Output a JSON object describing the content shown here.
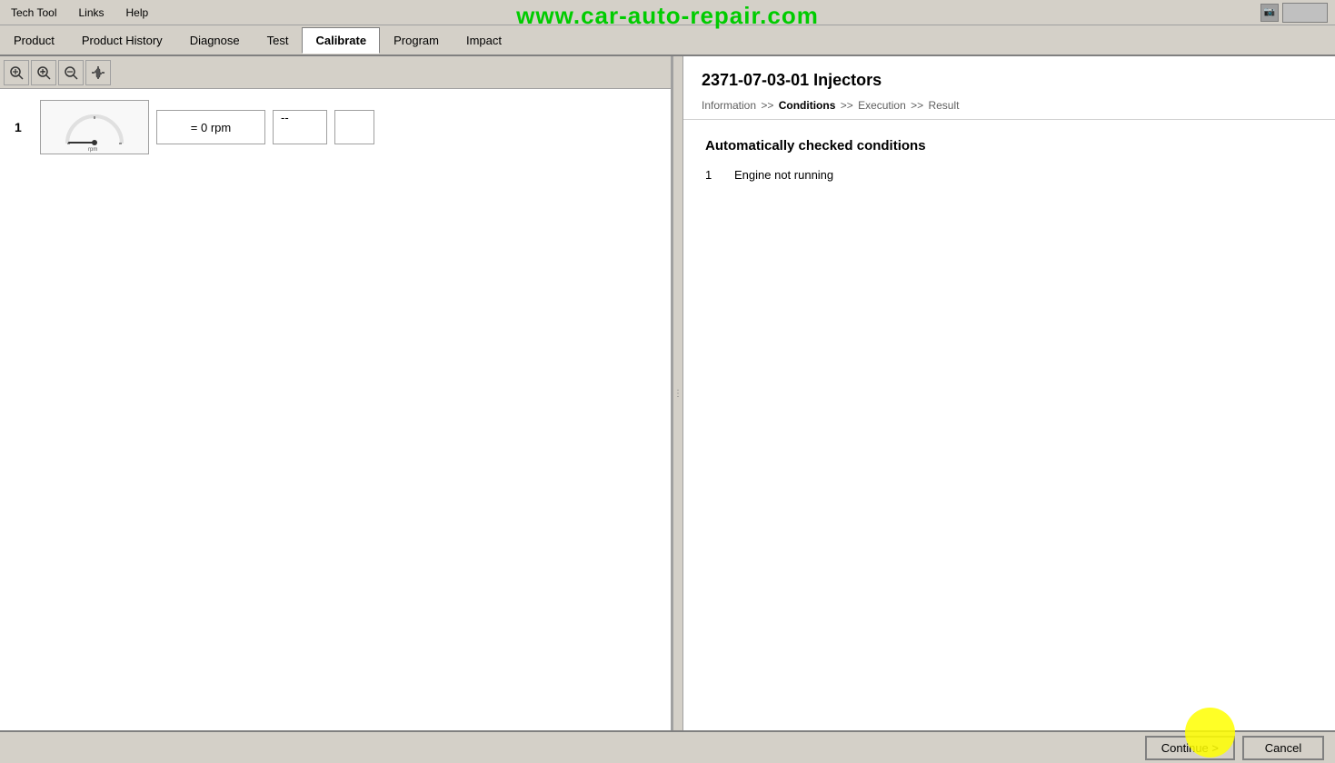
{
  "titleBar": {
    "menus": [
      "Tech Tool",
      "Links",
      "Help"
    ],
    "watermark": "www.car-auto-repair.com"
  },
  "menuBar": {
    "items": [
      {
        "label": "Product",
        "active": false
      },
      {
        "label": "Product History",
        "active": false
      },
      {
        "label": "Diagnose",
        "active": false
      },
      {
        "label": "Test",
        "active": false
      },
      {
        "label": "Calibrate",
        "active": true
      },
      {
        "label": "Program",
        "active": false
      },
      {
        "label": "Impact",
        "active": false
      }
    ]
  },
  "toolbar": {
    "zoom_in_label": "🔍",
    "zoom_plus_label": "➕",
    "zoom_minus_label": "➖",
    "pan_label": "✋"
  },
  "gauge": {
    "row_number": "1",
    "rpm_label": "rpm",
    "value_text": "= 0 rpm",
    "display_text": "--"
  },
  "rightPanel": {
    "title": "2371-07-03-01 Injectors",
    "breadcrumb": {
      "items": [
        {
          "label": "Information",
          "active": false
        },
        {
          "label": ">>",
          "is_sep": true
        },
        {
          "label": "Conditions",
          "active": true
        },
        {
          "label": ">>",
          "is_sep": true
        },
        {
          "label": "Execution",
          "active": false
        },
        {
          "label": ">>",
          "is_sep": true
        },
        {
          "label": "Result",
          "active": false
        }
      ]
    },
    "conditions_title": "Automatically checked conditions",
    "conditions": [
      {
        "number": "1",
        "text": "Engine not running"
      }
    ]
  },
  "statusBar": {
    "continue_label": "Continue >",
    "cancel_label": "Cancel"
  }
}
